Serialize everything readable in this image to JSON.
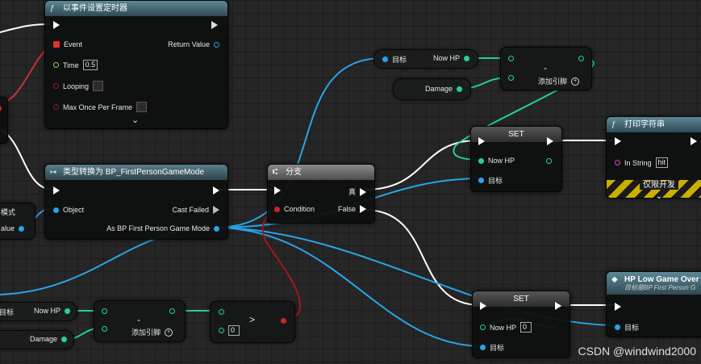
{
  "timer_node": {
    "title": "以事件设置定时器",
    "title_icon": "function-icon",
    "event_label": "Event",
    "return_label": "Return Value",
    "time_label": "Time",
    "time_value": "0.5",
    "looping_label": "Looping",
    "max_once_label": "Max Once Per Frame",
    "expand_glyph": "⌄"
  },
  "cast_node": {
    "title": "类型转换为 BP_FirstPersonGameMode",
    "object_label": "Object",
    "cast_failed_label": "Cast Failed",
    "as_label": "As BP First Person Game Mode"
  },
  "branch_node": {
    "title": "分支",
    "condition_label": "Condition",
    "true_label": "真",
    "false_label": "False"
  },
  "left_fragment": {
    "mode_label": "模式",
    "value_label": "alue",
    "target_label": "目标",
    "nowhp_label": "Now HP",
    "damage_label": "Damage"
  },
  "get_top": {
    "target_label": "目标",
    "nowhp_label": "Now HP",
    "damage_label": "Damage"
  },
  "subtract_top": {
    "symbol": "-",
    "add_pin_label": "添加引脚"
  },
  "subtract_bottom": {
    "symbol": "-",
    "add_pin_label": "添加引脚"
  },
  "compare_node": {
    "symbol": ">",
    "value": "0"
  },
  "set_top": {
    "title": "SET",
    "nowhp_label": "Now HP",
    "target_label": "目标"
  },
  "set_bottom": {
    "title": "SET",
    "nowhp_label": "Now HP",
    "nowhp_value": "0",
    "target_label": "目标"
  },
  "print_node": {
    "title": "打印字符串",
    "in_string_label": "In String",
    "in_string_value": "hit",
    "dev_only_label": "仅限开发",
    "expand_glyph": "⌄"
  },
  "hp_low_node": {
    "title": "HP Low Game Over",
    "subtitle": "目标是BP First Person G",
    "target_label": "目标"
  },
  "watermark": "CSDN @windwind2000",
  "colors": {
    "exec_wire": "#ffffff",
    "object_wire": "#2aa3e8",
    "float_wire": "#26d096",
    "bool_wire": "#a01818",
    "event_wire": "#c83232",
    "stripe_yellow": "#c9b000"
  }
}
